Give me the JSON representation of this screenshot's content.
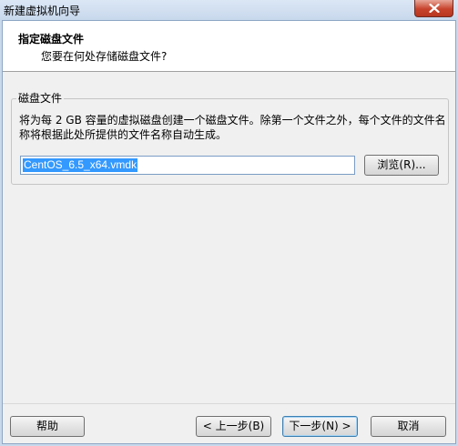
{
  "window": {
    "title": "新建虚拟机向导",
    "close_icon": "close-icon"
  },
  "header": {
    "title": "指定磁盘文件",
    "subtitle": "您要在何处存储磁盘文件?"
  },
  "disk_file_group": {
    "label": "磁盘文件",
    "description": "将为每 2 GB 容量的虚拟磁盘创建一个磁盘文件。除第一个文件之外，每个文件的文件名称将根据此处所提供的文件名称自动生成。",
    "filename_value": "CentOS_6.5_x64.vmdk",
    "browse_label": "浏览(R)..."
  },
  "footer": {
    "help_label": "帮助",
    "back_label": "< 上一步(B)",
    "next_label": "下一步(N) >",
    "cancel_label": "取消"
  }
}
